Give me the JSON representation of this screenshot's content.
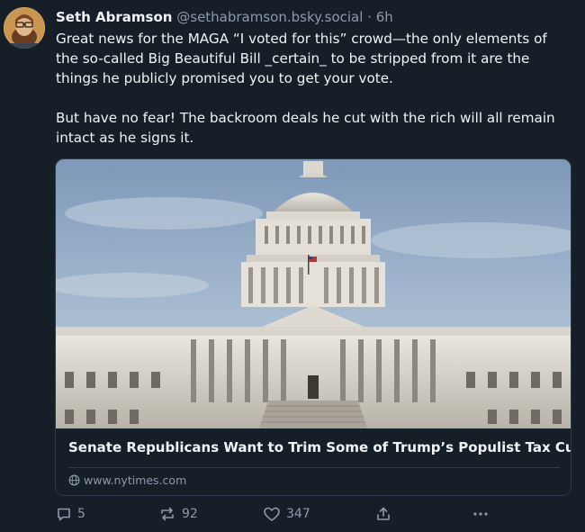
{
  "author": {
    "name": "Seth Abramson",
    "handle": "@sethabramson.bsky.social",
    "separator": "·",
    "time": "6h"
  },
  "post": {
    "paragraphs": [
      "Great news for the MAGA “I voted for this” crowd—the only elements of the so-called Big Beautiful Bill _certain_ to be stripped from it are the things he publicly promised you to get your vote.",
      "But have no fear! The backroom deals he cut with the rich will all remain intact as he signs it."
    ]
  },
  "link_card": {
    "title": "Senate Republicans Want to Trim Some of Trump’s Populist Tax Cuts",
    "domain": "www.nytimes.com",
    "domain_icon": "globe-icon"
  },
  "actions": {
    "replies": "5",
    "reposts": "92",
    "likes": "347",
    "reply_icon": "reply-icon",
    "repost_icon": "repost-icon",
    "like_icon": "heart-icon",
    "share_icon": "share-icon",
    "more_icon": "more-icon"
  },
  "colors": {
    "background": "#161e27",
    "text": "#f1f3f5",
    "muted": "#8d9aaa",
    "border": "#2e3b4a"
  }
}
